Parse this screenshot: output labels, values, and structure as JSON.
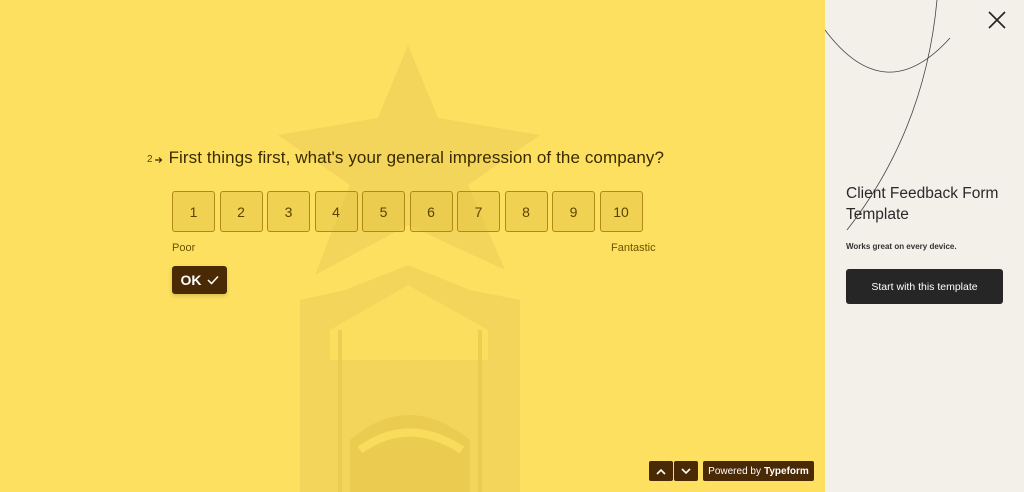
{
  "question": {
    "number": "2",
    "text": "First things first, what's your general impression of the company?"
  },
  "scale": {
    "options": [
      "1",
      "2",
      "3",
      "4",
      "5",
      "6",
      "7",
      "8",
      "9",
      "10"
    ],
    "min_label": "Poor",
    "max_label": "Fantastic"
  },
  "ok_button": {
    "label": "OK"
  },
  "footer": {
    "powered_prefix": "Powered by",
    "powered_brand": "Typeform"
  },
  "side_panel": {
    "title": "Client Feedback Form Template",
    "subtitle": "Works great on every device.",
    "cta_label": "Start with this template"
  },
  "colors": {
    "background": "#fde05f",
    "accent": "#4a2a05",
    "side_panel": "#f3efe9",
    "cta": "#262627"
  }
}
